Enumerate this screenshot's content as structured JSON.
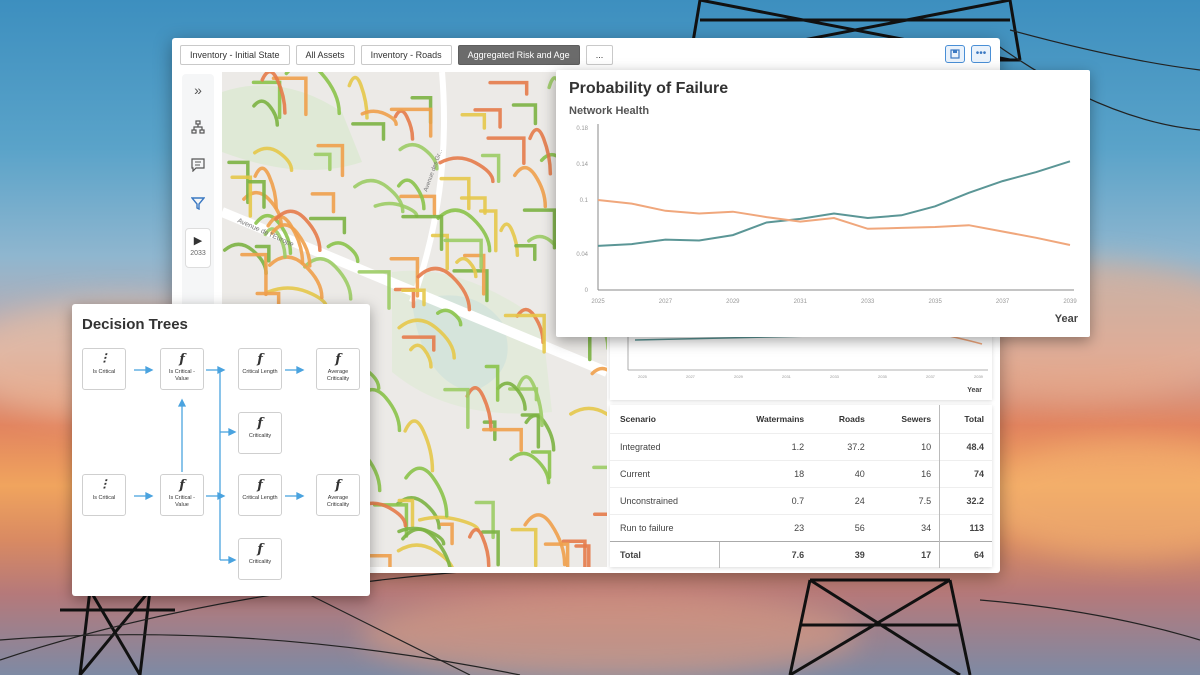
{
  "tabs": [
    {
      "label": "Inventory - Initial State",
      "active": false
    },
    {
      "label": "All Assets",
      "active": false
    },
    {
      "label": "Inventory - Roads",
      "active": false
    },
    {
      "label": "Aggregated Risk and Age",
      "active": true
    },
    {
      "label": "...",
      "active": false
    }
  ],
  "toolbar": {
    "save_icon": "save-icon",
    "more_icon": "more-icon"
  },
  "sidebar": {
    "expand_icon": "double-chevron-right-icon",
    "hierarchy_icon": "hierarchy-icon",
    "comment_icon": "comment-icon",
    "filter_icon": "filter-icon",
    "play_icon": "play-icon",
    "year": "2033"
  },
  "map": {
    "street_label": "Avenue de l'Europe",
    "street_label2": "Avenue des Gr..."
  },
  "pof": {
    "title": "Probability of Failure",
    "subtitle": "Network Health",
    "xlabel": "Year"
  },
  "chart_data": {
    "type": "line",
    "title": "Probability of Failure",
    "subtitle": "Network Health",
    "xlabel": "Year",
    "ylabel": "",
    "x": [
      2025,
      2026,
      2027,
      2028,
      2029,
      2030,
      2031,
      2032,
      2033,
      2034,
      2035,
      2036,
      2037,
      2038,
      2039
    ],
    "x_ticks": [
      "2025",
      "2027",
      "2029",
      "2031",
      "2033",
      "2035",
      "2037",
      "2039"
    ],
    "y_ticks": [
      "0",
      "0.04",
      "0.1",
      "0.14",
      "0.18"
    ],
    "ylim": [
      0,
      0.18
    ],
    "grid": false,
    "series": [
      {
        "color": "#5b9696",
        "values": [
          0.049,
          0.051,
          0.056,
          0.055,
          0.061,
          0.075,
          0.079,
          0.085,
          0.08,
          0.083,
          0.093,
          0.108,
          0.121,
          0.131,
          0.143
        ]
      },
      {
        "color": "#f0a77c",
        "values": [
          0.1,
          0.096,
          0.088,
          0.085,
          0.087,
          0.081,
          0.076,
          0.08,
          0.068,
          0.069,
          0.07,
          0.072,
          0.065,
          0.058,
          0.05
        ]
      }
    ]
  },
  "mini_chart": {
    "ticks": [
      "2025",
      "2027",
      "2029",
      "2031",
      "2033",
      "2035",
      "2037",
      "2039"
    ],
    "xlabel": "Year"
  },
  "table": {
    "headers": [
      "Scenario",
      "Watermains",
      "Roads",
      "Sewers",
      "Total"
    ],
    "rows": [
      [
        "Integrated",
        "1.2",
        "37.2",
        "10",
        "48.4"
      ],
      [
        "Current",
        "18",
        "40",
        "16",
        "74"
      ],
      [
        "Unconstrained",
        "0.7",
        "24",
        "7.5",
        "32.2"
      ],
      [
        "Run to failure",
        "23",
        "56",
        "34",
        "113"
      ]
    ],
    "footer": [
      "Total",
      "7.6",
      "39",
      "17",
      "64"
    ]
  },
  "decision_trees": {
    "title": "Decision Trees",
    "nodes": {
      "a1": "Is Critical",
      "b1": "Is Critical - Value",
      "c1": "Critical Length",
      "d1": "Average Criticality",
      "c2": "Criticality",
      "a3": "Is Critical",
      "b3": "Is Critical - Value",
      "c3": "Critical Length",
      "d3": "Average Criticality",
      "c4": "Criticality"
    },
    "fx_glyph": "f",
    "filter_glyph": "⫶"
  }
}
